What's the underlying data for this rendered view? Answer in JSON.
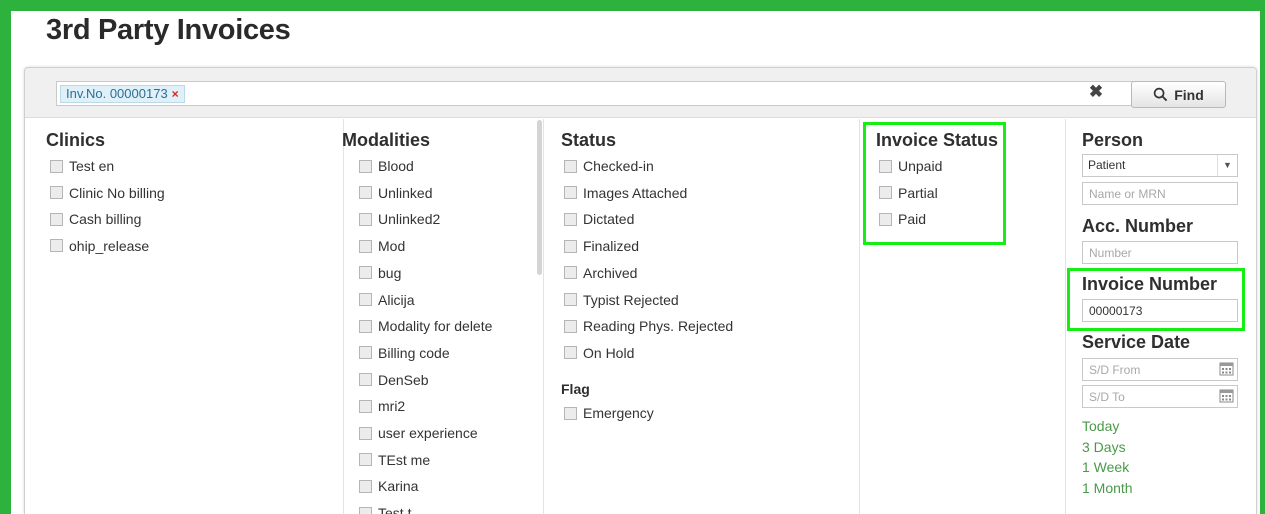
{
  "page": {
    "title": "3rd Party Invoices"
  },
  "search": {
    "tag_label": "Inv.No. 00000173",
    "tag_remove": "×",
    "clear_symbol": "✖",
    "find_label": "Find"
  },
  "clinics": {
    "title": "Clinics",
    "items": [
      "Test en",
      "Clinic No billing",
      "Cash billing",
      "ohip_release"
    ]
  },
  "modalities": {
    "title": "Modalities",
    "items": [
      "Blood",
      "Unlinked",
      "Unlinked2",
      "Mod",
      "bug",
      "Alicija",
      "Modality for delete",
      "Billing code",
      "DenSeb",
      "mri2",
      "user experience",
      "TEst me",
      "Karina",
      "Test t"
    ]
  },
  "status": {
    "title": "Status",
    "items": [
      "Checked-in",
      "Images Attached",
      "Dictated",
      "Finalized",
      "Archived",
      "Typist Rejected",
      "Reading Phys. Rejected",
      "On Hold"
    ]
  },
  "flag": {
    "title": "Flag",
    "items": [
      "Emergency"
    ]
  },
  "invoice_status": {
    "title": "Invoice Status",
    "items": [
      "Unpaid",
      "Partial",
      "Paid"
    ]
  },
  "person": {
    "title": "Person",
    "select_value": "Patient",
    "name_placeholder": "Name or MRN"
  },
  "acc_number": {
    "title": "Acc. Number",
    "placeholder": "Number"
  },
  "invoice_number": {
    "title": "Invoice Number",
    "value": "00000173"
  },
  "service_date": {
    "title": "Service Date",
    "from_placeholder": "S/D From",
    "to_placeholder": "S/D To",
    "quick_links": [
      "Today",
      "3 Days",
      "1 Week",
      "1 Month"
    ]
  },
  "colors": {
    "frame": "#2db33d",
    "highlight": "#15ee15",
    "link": "#4a9a4a",
    "tag_remove": "#d8261c"
  }
}
